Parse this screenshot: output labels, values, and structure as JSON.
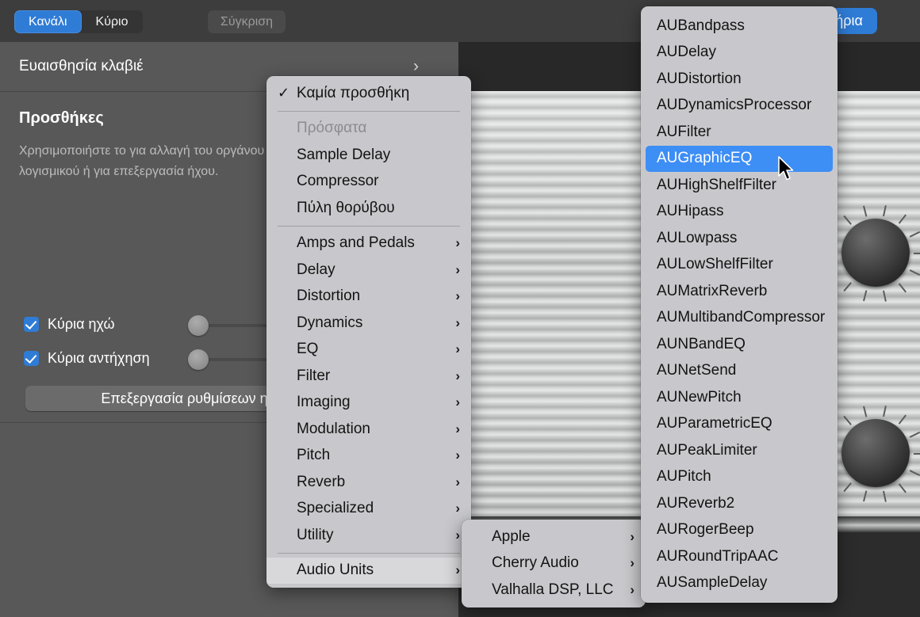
{
  "tabs": {
    "channel": "Κανάλι",
    "main": "Κύριο",
    "compare": "Σύγκριση"
  },
  "top_right_button": "ιστήρια",
  "inspector": {
    "sensitivity_row": "Ευαισθησία κλαβιέ",
    "sensitivity_chevron": "›",
    "section_title": "Προσθήκες",
    "section_description": "Χρησιμοποιήστε το για αλλαγή του οργάνου λογισμικού ή για επεξεργασία ήχου.",
    "checkbox_echo": "Κύρια ηχώ",
    "checkbox_reverb": "Κύρια αντήχηση",
    "edit_button": "Επεξεργασία ρυθμίσεων ηχο"
  },
  "menu_main": {
    "none_label": "Καμία προσθήκη",
    "check_glyph": "✓",
    "recent_header": "Πρόσφατα",
    "recent": [
      "Sample Delay",
      "Compressor",
      "Πύλη θορύβου"
    ],
    "categories": [
      "Amps and Pedals",
      "Delay",
      "Distortion",
      "Dynamics",
      "EQ",
      "Filter",
      "Imaging",
      "Modulation",
      "Pitch",
      "Reverb",
      "Specialized",
      "Utility"
    ],
    "audio_units": "Audio Units",
    "arrow_glyph": "›"
  },
  "menu_vendors": {
    "items": [
      "Apple",
      "Cherry Audio",
      "Valhalla DSP, LLC"
    ],
    "arrow_glyph": "›"
  },
  "menu_audio_units": {
    "selected": "AUGraphicEQ",
    "items": [
      "AUBandpass",
      "AUDelay",
      "AUDistortion",
      "AUDynamicsProcessor",
      "AUFilter",
      "AUGraphicEQ",
      "AUHighShelfFilter",
      "AUHipass",
      "AULowpass",
      "AULowShelfFilter",
      "AUMatrixReverb",
      "AUMultibandCompressor",
      "AUNBandEQ",
      "AUNetSend",
      "AUNewPitch",
      "AUParametricEQ",
      "AUPeakLimiter",
      "AUPitch",
      "AUReverb2",
      "AURogerBeep",
      "AURoundTripAAC",
      "AUSampleDelay"
    ]
  },
  "colors": {
    "accent_blue": "#2f7cd6",
    "menu_highlight": "#3d8ef5",
    "panel_bg": "#585858",
    "menu_bg": "#c8c8cc"
  }
}
